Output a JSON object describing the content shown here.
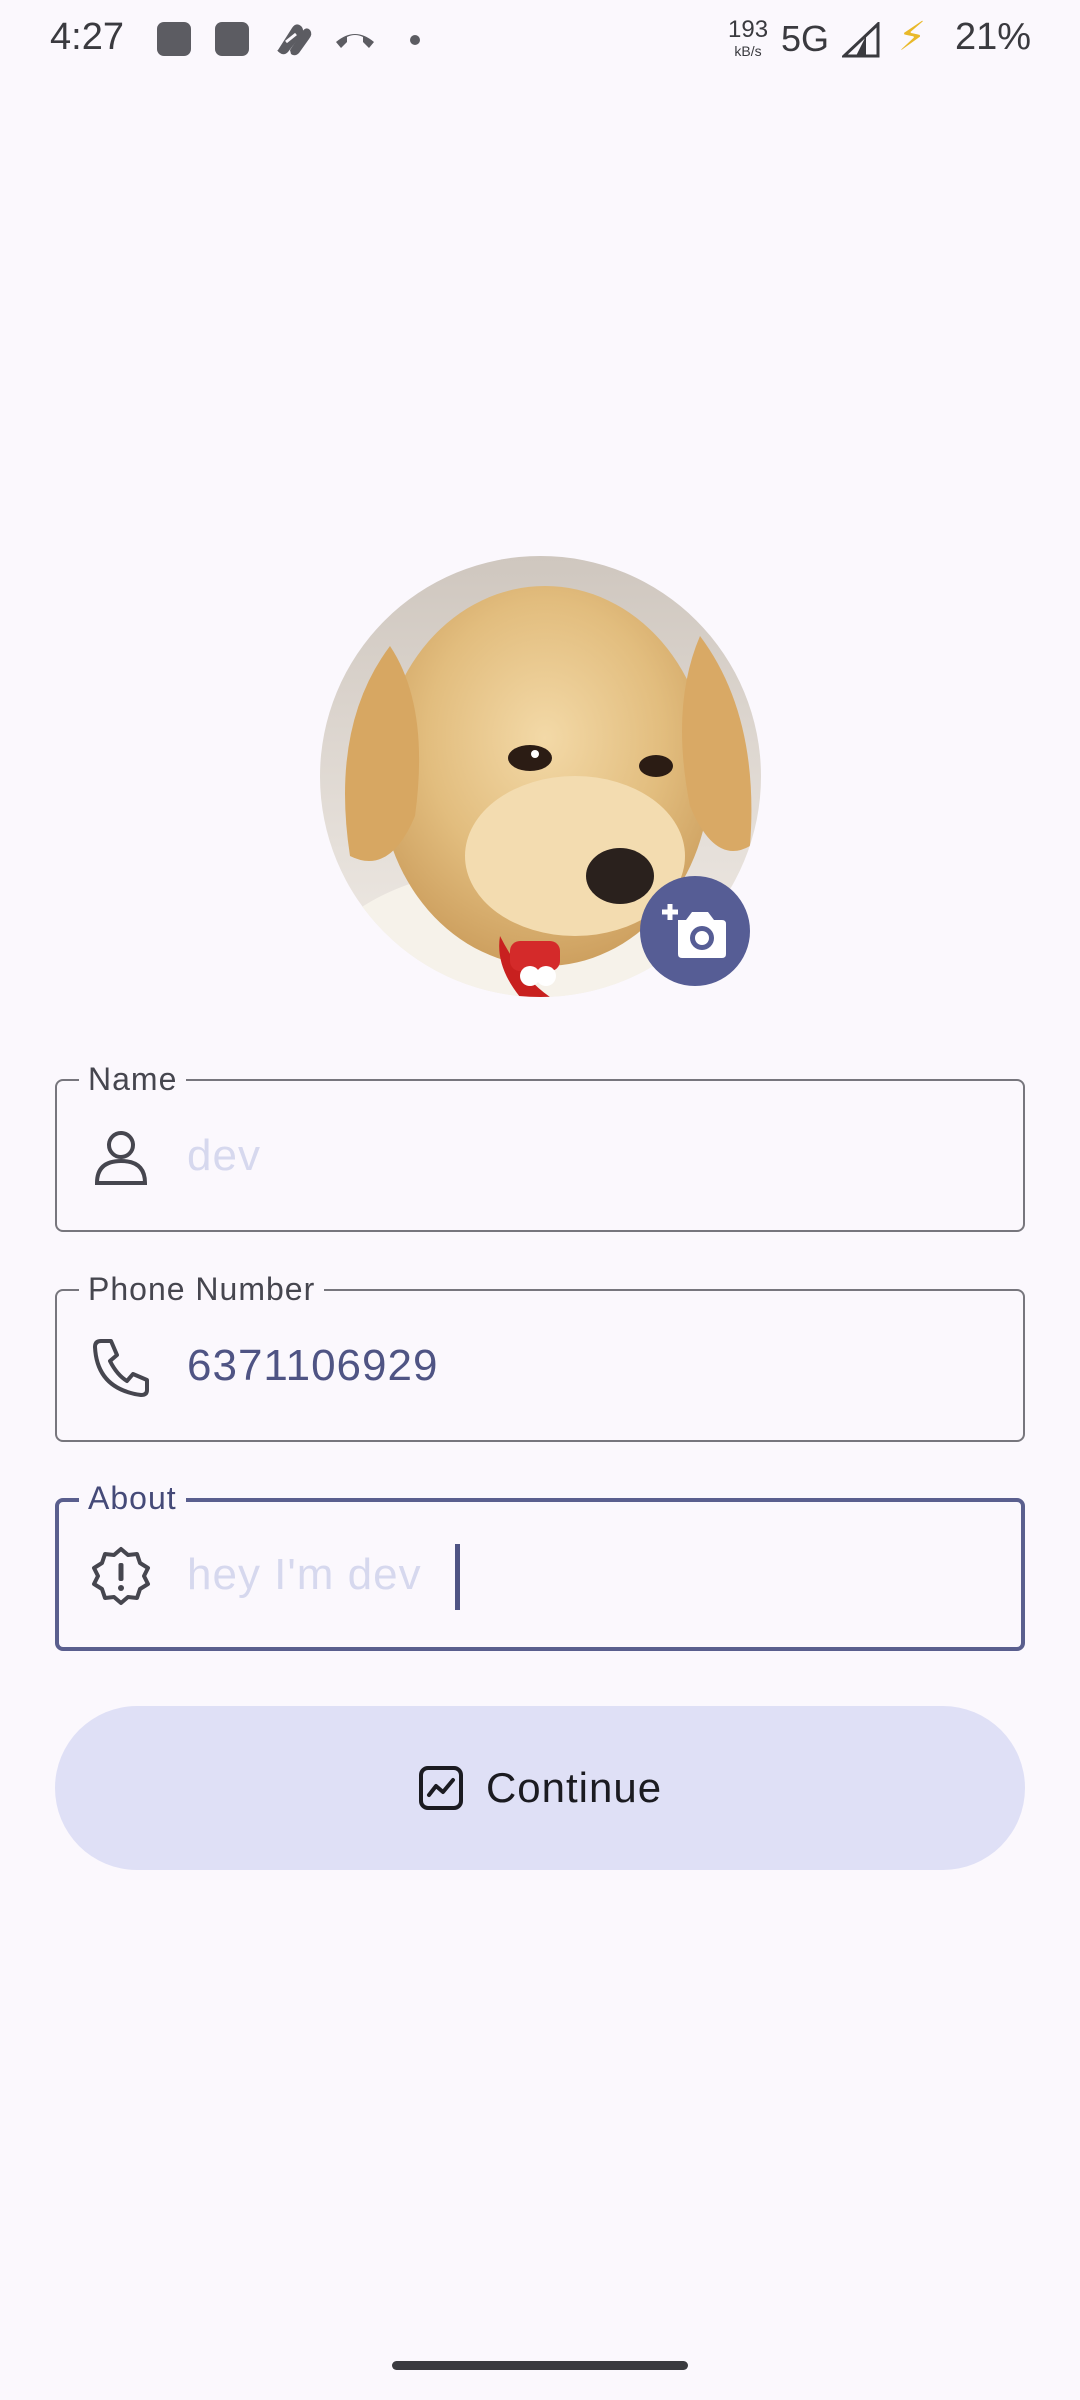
{
  "status_bar": {
    "time": "4:27",
    "notification_icons": [
      "app-square-icon",
      "app-square-icon",
      "link-icon",
      "missed-call-icon",
      "more-dot-icon"
    ],
    "speed_value": "193",
    "speed_unit": "kB/s",
    "network": "5G",
    "battery": "21%",
    "charging": true
  },
  "profile": {
    "avatar_description_icon": "puppy-photo",
    "camera_button_icon": "add-photo-camera-icon"
  },
  "form": {
    "name": {
      "label": "Name",
      "placeholder": "dev",
      "value": "",
      "icon": "person-icon"
    },
    "phone": {
      "label": "Phone Number",
      "value": "6371106929",
      "icon": "phone-icon"
    },
    "about": {
      "label": "About",
      "placeholder": "hey I'm dev",
      "value": "",
      "icon": "alert-badge-icon",
      "focused": true
    }
  },
  "continue_button": {
    "label": "Continue",
    "icon": "chart-icon"
  },
  "colors": {
    "background": "#fbf8fd",
    "primary": "#565d95",
    "button_container": "#dfe0f6",
    "outline": "#77767d",
    "focused_outline": "#5a5f8e"
  }
}
